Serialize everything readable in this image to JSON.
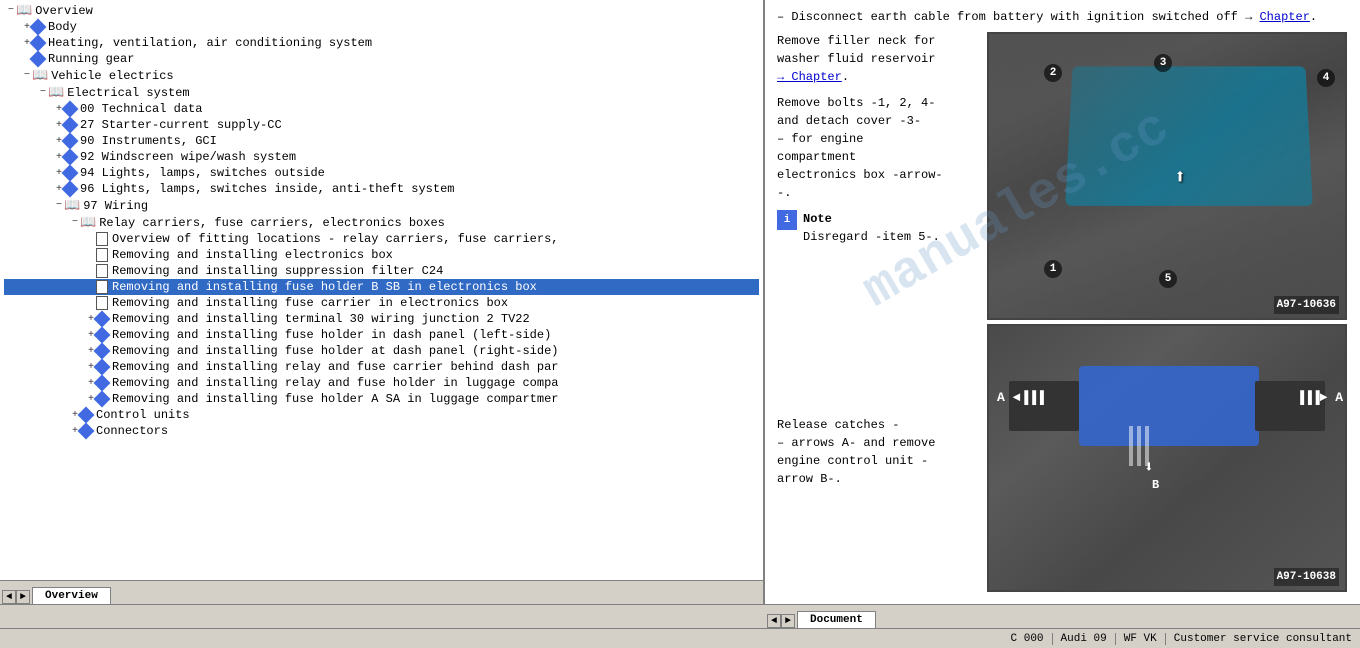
{
  "left_panel": {
    "tree_items": [
      {
        "id": 1,
        "level": 0,
        "type": "book",
        "label": "Overview",
        "expanded": true,
        "hasChildren": true
      },
      {
        "id": 2,
        "level": 1,
        "type": "diamond",
        "label": "Body",
        "expanded": false,
        "hasChildren": false
      },
      {
        "id": 3,
        "level": 1,
        "type": "diamond",
        "label": "Heating, ventilation, air conditioning system",
        "expanded": false
      },
      {
        "id": 4,
        "level": 1,
        "type": "diamond",
        "label": "Running gear",
        "expanded": false
      },
      {
        "id": 5,
        "level": 1,
        "type": "book",
        "label": "Vehicle electrics",
        "expanded": true,
        "hasChildren": true
      },
      {
        "id": 6,
        "level": 2,
        "type": "book",
        "label": "Electrical system",
        "expanded": true,
        "hasChildren": true
      },
      {
        "id": 7,
        "level": 3,
        "type": "diamond",
        "label": "00 Technical data",
        "expanded": false
      },
      {
        "id": 8,
        "level": 3,
        "type": "diamond",
        "label": "27 Starter-current supply-CC",
        "expanded": false
      },
      {
        "id": 9,
        "level": 3,
        "type": "diamond",
        "label": "90 Instruments, GCI",
        "expanded": false
      },
      {
        "id": 10,
        "level": 3,
        "type": "diamond",
        "label": "92 Windscreen wipe/wash system",
        "expanded": false
      },
      {
        "id": 11,
        "level": 3,
        "type": "diamond",
        "label": "94 Lights, lamps, switches outside",
        "expanded": false
      },
      {
        "id": 12,
        "level": 3,
        "type": "diamond",
        "label": "96 Lights, lamps, switches inside, anti-theft system",
        "expanded": false
      },
      {
        "id": 13,
        "level": 3,
        "type": "book",
        "label": "97 Wiring",
        "expanded": true,
        "hasChildren": true
      },
      {
        "id": 14,
        "level": 4,
        "type": "book",
        "label": "Relay carriers, fuse carriers, electronics boxes",
        "expanded": true,
        "hasChildren": true
      },
      {
        "id": 15,
        "level": 5,
        "type": "doc",
        "label": "Overview of fitting locations - relay carriers, fuse carriers,",
        "selected": false
      },
      {
        "id": 16,
        "level": 5,
        "type": "doc",
        "label": "Removing and installing electronics box",
        "selected": false
      },
      {
        "id": 17,
        "level": 5,
        "type": "doc",
        "label": "Removing and installing suppression filter C24",
        "selected": false
      },
      {
        "id": 18,
        "level": 5,
        "type": "doc",
        "label": "Removing and installing fuse holder B SB in electronics box",
        "selected": true,
        "highlighted": true
      },
      {
        "id": 19,
        "level": 5,
        "type": "doc",
        "label": "Removing and installing fuse carrier in electronics box",
        "selected": false
      },
      {
        "id": 20,
        "level": 5,
        "type": "diamond",
        "label": "Removing and installing terminal 30 wiring junction 2 TV22",
        "selected": false
      },
      {
        "id": 21,
        "level": 5,
        "type": "diamond",
        "label": "Removing and installing fuse holder in dash panel (left-side)",
        "selected": false
      },
      {
        "id": 22,
        "level": 5,
        "type": "diamond",
        "label": "Removing and installing fuse holder at dash panel (right-side)",
        "selected": false
      },
      {
        "id": 23,
        "level": 5,
        "type": "diamond",
        "label": "Removing and installing relay and fuse carrier behind dash par",
        "selected": false
      },
      {
        "id": 24,
        "level": 5,
        "type": "diamond",
        "label": "Removing and installing relay and fuse holder in luggage comp",
        "selected": false
      },
      {
        "id": 25,
        "level": 5,
        "type": "diamond",
        "label": "Removing and installing fuse holder A SA in luggage compartmer",
        "selected": false
      },
      {
        "id": 26,
        "level": 4,
        "type": "diamond",
        "label": "Control units",
        "selected": false
      },
      {
        "id": 27,
        "level": 4,
        "type": "diamond",
        "label": "Connectors",
        "selected": false
      }
    ],
    "tab_label": "Overview"
  },
  "right_panel": {
    "tab_label": "Document",
    "content": {
      "line1": "– Disconnect earth cable from battery with ignition switched off →",
      "chapter_link": "Chapter",
      "step1_prefix": "Remove filler neck for",
      "step1_line2": "washer fluid reservoir",
      "step1_link": "→ Chapter",
      "step2": "Remove bolts -1, 2, 4-",
      "step2_line2": "and detach cover -3-",
      "step2_line3": "– for engine",
      "step2_line4": "compartment",
      "step2_line5": "electronics box -arrow-",
      "note_label": "Note",
      "note_text": "Disregard -item 5-.",
      "step3_prefix": "Release catches -",
      "step3_line2": "– arrows A- and remove",
      "step3_line3": "engine control unit -",
      "step3_line4": "arrow B-.",
      "image1_label": "A97-10636",
      "image2_label": "A97-10638",
      "num1": "1",
      "num2": "2",
      "num3": "3",
      "num4": "4",
      "num5": "5",
      "arrow_a": "A",
      "arrow_b": "B"
    }
  },
  "status_bar": {
    "segment1": "",
    "segment2": "C 000",
    "segment3": "Audi 09",
    "segment4": "WF VK",
    "segment5": "Customer service consultant"
  },
  "icons": {
    "expand": "−",
    "collapse": "+",
    "nav_left": "◄",
    "nav_right": "►"
  }
}
